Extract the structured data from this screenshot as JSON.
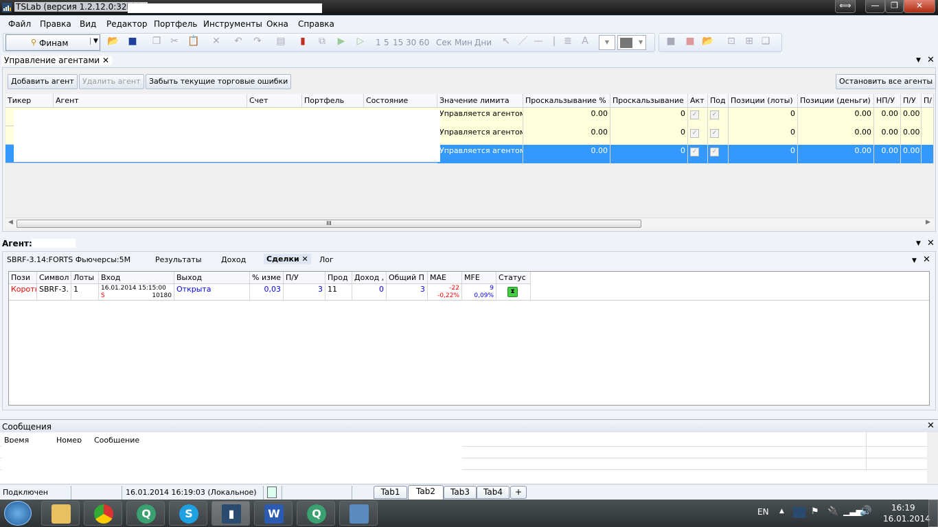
{
  "window": {
    "title": "TSLab (версия 1.2.12.0:32bit) -",
    "buttons": {
      "switch": "⟺",
      "minimize": "—",
      "restore": "❐",
      "close": "✕"
    }
  },
  "menu": [
    "Файл",
    "Правка",
    "Вид",
    "Редактор",
    "Портфель",
    "Инструменты",
    "Окна",
    "Справка"
  ],
  "toolbar": {
    "provider": "Финам",
    "timeframes": [
      "1",
      "5",
      "15",
      "30",
      "60"
    ],
    "units": [
      "Сек",
      "Мин",
      "Дни"
    ]
  },
  "agents_panel": {
    "title": "Управление агентами",
    "buttons": {
      "add": "Добавить агент",
      "remove": "Удалить агент",
      "forget": "Забыть текущие торговые  ошибки",
      "stop_all": "Остановить все агенты"
    },
    "columns": [
      "Тикер",
      "Агент",
      "Счет",
      "Портфель",
      "Состояние",
      "Значение лимита",
      "Проскальзывание %",
      "Проскальзывание",
      "Акт",
      "Под",
      "Позиции (лоты)",
      "Позиции (деньги)",
      "НП/У",
      "П/У",
      "П/"
    ],
    "rows": [
      {
        "limit": "Управляется агентом",
        "slip_pct": "0.00",
        "slip": "0",
        "act": true,
        "sub": true,
        "pos_lots": "0",
        "pos_money": "0.00",
        "npu": "0.00",
        "pu": "0.00",
        "selected": false
      },
      {
        "limit": "Управляется агентом",
        "slip_pct": "0.00",
        "slip": "0",
        "act": true,
        "sub": true,
        "pos_lots": "0",
        "pos_money": "0.00",
        "npu": "0.00",
        "pu": "0.00",
        "selected": false
      },
      {
        "limit": "Управляется агентом",
        "slip_pct": "0.00",
        "slip": "0",
        "act": true,
        "sub": true,
        "pos_lots": "0",
        "pos_money": "0.00",
        "npu": "0.00",
        "pu": "0.00",
        "selected": true
      }
    ]
  },
  "agent_panel": {
    "title": "Агент:",
    "symbol": "SBRF-3.14:FORTS Фьючерсы:5M",
    "tabs": [
      "Результаты",
      "Доход",
      "Сделки",
      "Лог"
    ],
    "active_tab": "Сделки",
    "columns": [
      "Пози",
      "Символ",
      "Лоты",
      "Вход",
      "Выход",
      "% изме",
      "П/У",
      "Прод",
      "Доход ,",
      "Общий П",
      "MAE",
      "MFE",
      "Статус"
    ],
    "rows": [
      {
        "position": "Коротк",
        "symbol": "SBRF-3.",
        "lots": "1",
        "entry_time": "16.01.2014 15:15:00",
        "entry_side": "S",
        "entry_price": "10180",
        "exit": "Открыта",
        "pct": "0,03",
        "pnl": "3",
        "duration": "11",
        "income": "0",
        "total": "3",
        "mae": "-22",
        "mae_pct": "-0,22%",
        "mfe": "9",
        "mfe_pct": "0,09%",
        "status": "open-hourglass"
      }
    ]
  },
  "messages": {
    "title": "Сообщения",
    "columns": [
      "Время",
      "Номер",
      "Сообщение"
    ]
  },
  "statusbar": {
    "connection": "Подключен",
    "datetime": "16.01.2014 16:19:03 (Локальное)",
    "tabs": [
      "Tab1",
      "Tab2",
      "Tab3",
      "Tab4"
    ],
    "active_tab": "Tab2",
    "add": "+"
  },
  "taskbar": {
    "lang": "EN",
    "time": "16:19",
    "date": "16.01.2014"
  },
  "colors": {
    "selected": "#3399ff",
    "row_yellow": "#ffffdc",
    "short": "#ff0000",
    "blue_values": "#0000ff"
  }
}
